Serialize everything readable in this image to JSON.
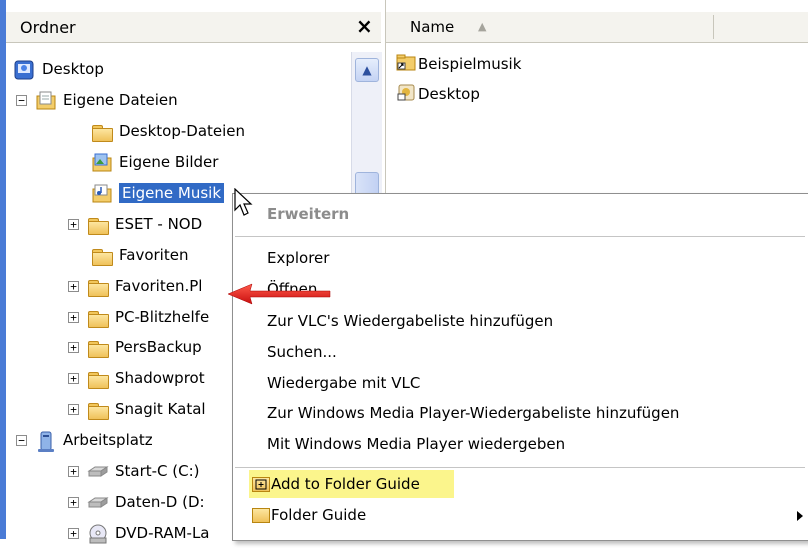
{
  "left_pane": {
    "title": "Ordner",
    "close": "×",
    "tree": [
      {
        "label": "Desktop",
        "expander": ""
      },
      {
        "label": "Eigene Dateien",
        "expander": "−"
      },
      {
        "label": "Desktop-Dateien",
        "expander": ""
      },
      {
        "label": "Eigene Bilder",
        "expander": ""
      },
      {
        "label": "Eigene Musik",
        "expander": ""
      },
      {
        "label": "ESET - NOD",
        "expander": "+"
      },
      {
        "label": "Favoriten",
        "expander": ""
      },
      {
        "label": "Favoriten.Pl",
        "expander": "+"
      },
      {
        "label": "PC-Blitzhelfe",
        "expander": "+"
      },
      {
        "label": "PersBackup",
        "expander": "+"
      },
      {
        "label": "Shadowprot",
        "expander": "+"
      },
      {
        "label": "Snagit Katal",
        "expander": "+"
      },
      {
        "label": "Arbeitsplatz",
        "expander": "−"
      },
      {
        "label": "Start-C (C:)",
        "expander": "+"
      },
      {
        "label": "Daten-D (D:",
        "expander": "+"
      },
      {
        "label": "DVD-RAM-La",
        "expander": "+"
      }
    ]
  },
  "right_pane": {
    "column_name": "Name",
    "sort_icon": "▲",
    "files": [
      "Beispielmusik",
      "Desktop"
    ]
  },
  "context_menu": {
    "header": "Erweitern",
    "items": [
      "Explorer",
      "Öffnen",
      "Zur VLC's Wiedergabeliste hinzufügen",
      "Suchen...",
      "Wiedergabe mit VLC",
      "Zur Windows Media Player-Wiedergabeliste hinzufügen",
      "Mit Windows Media Player wiedergeben"
    ],
    "add_folder_guide": "Add to Folder Guide",
    "folder_guide": "Folder Guide"
  },
  "colors": {
    "selection": "#316ac5",
    "highlight": "#fbf58c",
    "arrow": "#e01010"
  }
}
